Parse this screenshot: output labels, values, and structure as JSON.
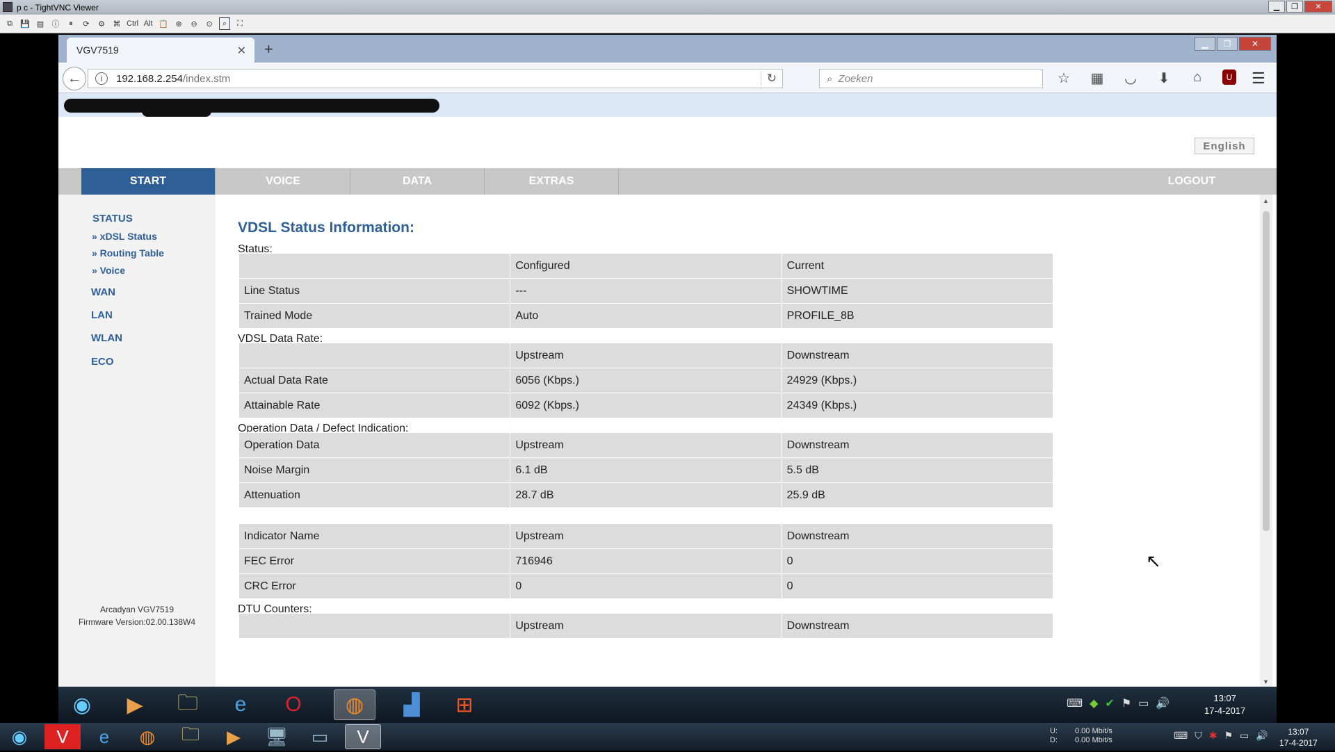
{
  "vnc": {
    "title": "p c - TightVNC Viewer",
    "toolbar": [
      "new-connection",
      "save",
      "options",
      "info",
      "pause",
      "refresh",
      "ctrl-alt-del",
      "ctrl-esc",
      "Ctrl",
      "Alt",
      "clipboard",
      "zoom-in",
      "zoom-out",
      "zoom-100",
      "zoom-fit",
      "fullscreen"
    ],
    "ctrl_label": "Ctrl",
    "alt_label": "Alt"
  },
  "browser": {
    "tab_title": "VGV7519",
    "url_host": "192.168.2.254",
    "url_path": "/index.stm",
    "search_placeholder": "Zoeken"
  },
  "router": {
    "language_button": "English",
    "menu": [
      "START",
      "VOICE",
      "DATA",
      "EXTRAS"
    ],
    "logout": "LOGOUT",
    "sidebar": {
      "status": "STATUS",
      "sub": [
        "» xDSL Status",
        "» Routing Table",
        "» Voice"
      ],
      "items": [
        "WAN",
        "LAN",
        "WLAN",
        "ECO"
      ]
    },
    "model": "Arcadyan VGV7519",
    "firmware": "Firmware Version:02.00.138W4"
  },
  "content": {
    "title": "VDSL Status Information:",
    "status_label": "Status:",
    "status_table": [
      [
        "",
        "Configured",
        "Current"
      ],
      [
        "Line Status",
        "---",
        "SHOWTIME"
      ],
      [
        "Trained Mode",
        "Auto",
        "PROFILE_8B"
      ]
    ],
    "datarate_label": "VDSL Data Rate:",
    "datarate_table": [
      [
        "",
        "Upstream",
        "Downstream"
      ],
      [
        "Actual Data Rate",
        "6056 (Kbps.)",
        "24929 (Kbps.)"
      ],
      [
        "Attainable Rate",
        "6092 (Kbps.)",
        "24349 (Kbps.)"
      ]
    ],
    "operation_label": "Operation Data / Defect Indication:",
    "operation_table": [
      [
        "Operation Data",
        "Upstream",
        "Downstream"
      ],
      [
        "Noise Margin",
        "6.1 dB",
        "5.5 dB"
      ],
      [
        "Attenuation",
        "28.7 dB",
        "25.9 dB"
      ]
    ],
    "indicator_table": [
      [
        "Indicator Name",
        "Upstream",
        "Downstream"
      ],
      [
        "FEC Error",
        "716946",
        "0"
      ],
      [
        "CRC Error",
        "0",
        "0"
      ]
    ],
    "dtu_label": "DTU Counters:",
    "dtu_table": [
      [
        "",
        "Upstream",
        "Downstream"
      ]
    ]
  },
  "taskbar_inner": {
    "clock_time": "13:07",
    "clock_date": "17-4-2017"
  },
  "taskbar_outer": {
    "net_up_label": "U:",
    "net_up": "0.00 Mbit/s",
    "net_down_label": "D:",
    "net_down": "0.00 Mbit/s",
    "clock_time": "13:07",
    "clock_date": "17-4-2017"
  },
  "colors": {
    "accent": "#2e5f96",
    "menu_bg": "#c8c8c8",
    "cell_bg": "#dcdcdc"
  }
}
